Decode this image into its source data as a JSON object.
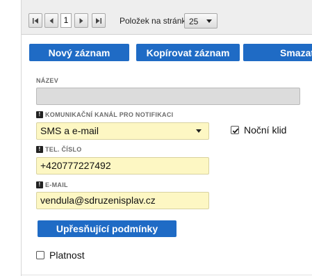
{
  "pager": {
    "page": "1",
    "per_page_label": "Položek na stránku",
    "per_page_value": "25"
  },
  "actions": {
    "new_label": "Nový záznam",
    "copy_label": "Kopírovat záznam",
    "delete_label": "Smazat"
  },
  "form": {
    "name": {
      "label": "NÁZEV",
      "value": ""
    },
    "channel": {
      "label": "KOMUNIKAČNÍ KANÁL PRO NOTIFIKACI",
      "value": "SMS a e-mail"
    },
    "quiet": {
      "label": "Noční klid",
      "checked": true
    },
    "phone": {
      "label": "TEL. ČÍSLO",
      "value": "+420777227492"
    },
    "email": {
      "label": "E-MAIL",
      "value": "vendula@sdruzenisplav.cz"
    },
    "conditions_label": "Upřesňující podmínky",
    "validity": {
      "label": "Platnost",
      "checked": false
    }
  },
  "colors": {
    "accent": "#1f6bc5",
    "field_highlight": "#fdf7c3",
    "field_disabled": "#dcdcdc"
  },
  "icons": {
    "first": "first-page-icon",
    "prev": "prev-page-icon",
    "next": "next-page-icon",
    "last": "last-page-icon",
    "required": "required-icon",
    "dropdown": "chevron-down-icon",
    "check": "check-icon"
  }
}
